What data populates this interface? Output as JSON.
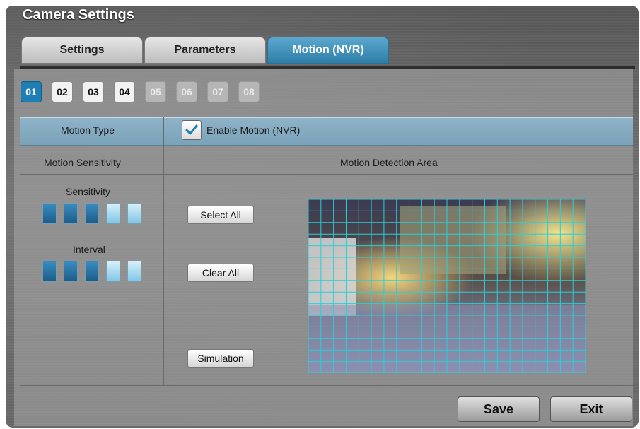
{
  "window": {
    "title": "Camera Settings"
  },
  "tabs": [
    {
      "label": "Settings"
    },
    {
      "label": "Parameters"
    },
    {
      "label": "Motion (NVR)"
    }
  ],
  "channels": [
    "01",
    "02",
    "03",
    "04",
    "05",
    "06",
    "07",
    "08"
  ],
  "motion_type": {
    "label": "Motion Type",
    "checkbox_label": "Enable Motion (NVR)",
    "checked": true
  },
  "sensitivity_panel": {
    "header": "Motion Sensitivity",
    "sensitivity_label": "Sensitivity",
    "sensitivity_level": 3,
    "sensitivity_max": 5,
    "interval_label": "Interval",
    "interval_level": 3,
    "interval_max": 5
  },
  "detection_area": {
    "header": "Motion Detection Area",
    "select_all": "Select All",
    "clear_all": "Clear All",
    "simulation": "Simulation",
    "grid_cols": 22,
    "grid_rows": 15
  },
  "footer": {
    "save": "Save",
    "exit": "Exit"
  },
  "colors": {
    "accent": "#2e7ea8",
    "grid": "#28d0d8"
  }
}
